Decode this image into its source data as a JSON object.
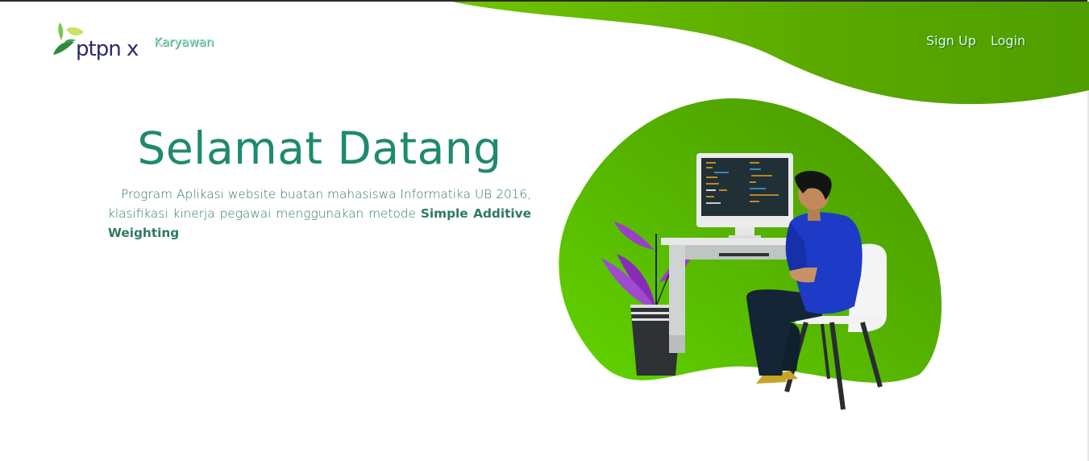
{
  "brand": {
    "logo_text": "ptpn x",
    "colors": {
      "primary_green": "#5cb800",
      "title_teal": "#1e8a6e",
      "logo_navy": "#2a2a6c"
    }
  },
  "nav": {
    "karyawan_label": "Karyawan",
    "signup_label": "Sign Up",
    "login_label": "Login"
  },
  "hero": {
    "title": "Selamat Datang",
    "description": "Program Aplikasi website buatan mahasiswa Informatika UB 2016, klasifikasi kinerja pegawai menggunakan metode ",
    "method": "Simple Additive Weighting"
  },
  "illustration": {
    "icon": "person-at-computer-icon"
  }
}
